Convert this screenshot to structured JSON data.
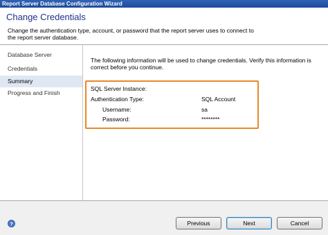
{
  "window": {
    "title": "Report Server Database Configuration Wizard"
  },
  "header": {
    "title": "Change Credentials",
    "description": "Change the authentication type, account, or password that the report server uses to connect to the report server database."
  },
  "sidebar": {
    "items": [
      {
        "label": "Database Server",
        "active": false
      },
      {
        "label": "Credentials",
        "active": false
      },
      {
        "label": "Summary",
        "active": true
      },
      {
        "label": "Progress and Finish",
        "active": false
      }
    ]
  },
  "summary": {
    "intro": "The following information will be used to change credentials. Verify this information is correct before you continue.",
    "rows": [
      {
        "label": "SQL Server Instance:",
        "value": ""
      },
      {
        "label": "Authentication Type:",
        "value": "SQL Account"
      },
      {
        "label": "Username:",
        "value": "sa"
      },
      {
        "label": "Password:",
        "value": "********"
      }
    ]
  },
  "footer": {
    "help_icon": "help-icon",
    "previous_label": "Previous",
    "next_label": "Next",
    "cancel_label": "Cancel"
  },
  "colors": {
    "title_bar": "#2f63b5",
    "header_title": "#1e3287",
    "highlight_box": "#e8872a",
    "selected_item": "#dfe7f3"
  }
}
